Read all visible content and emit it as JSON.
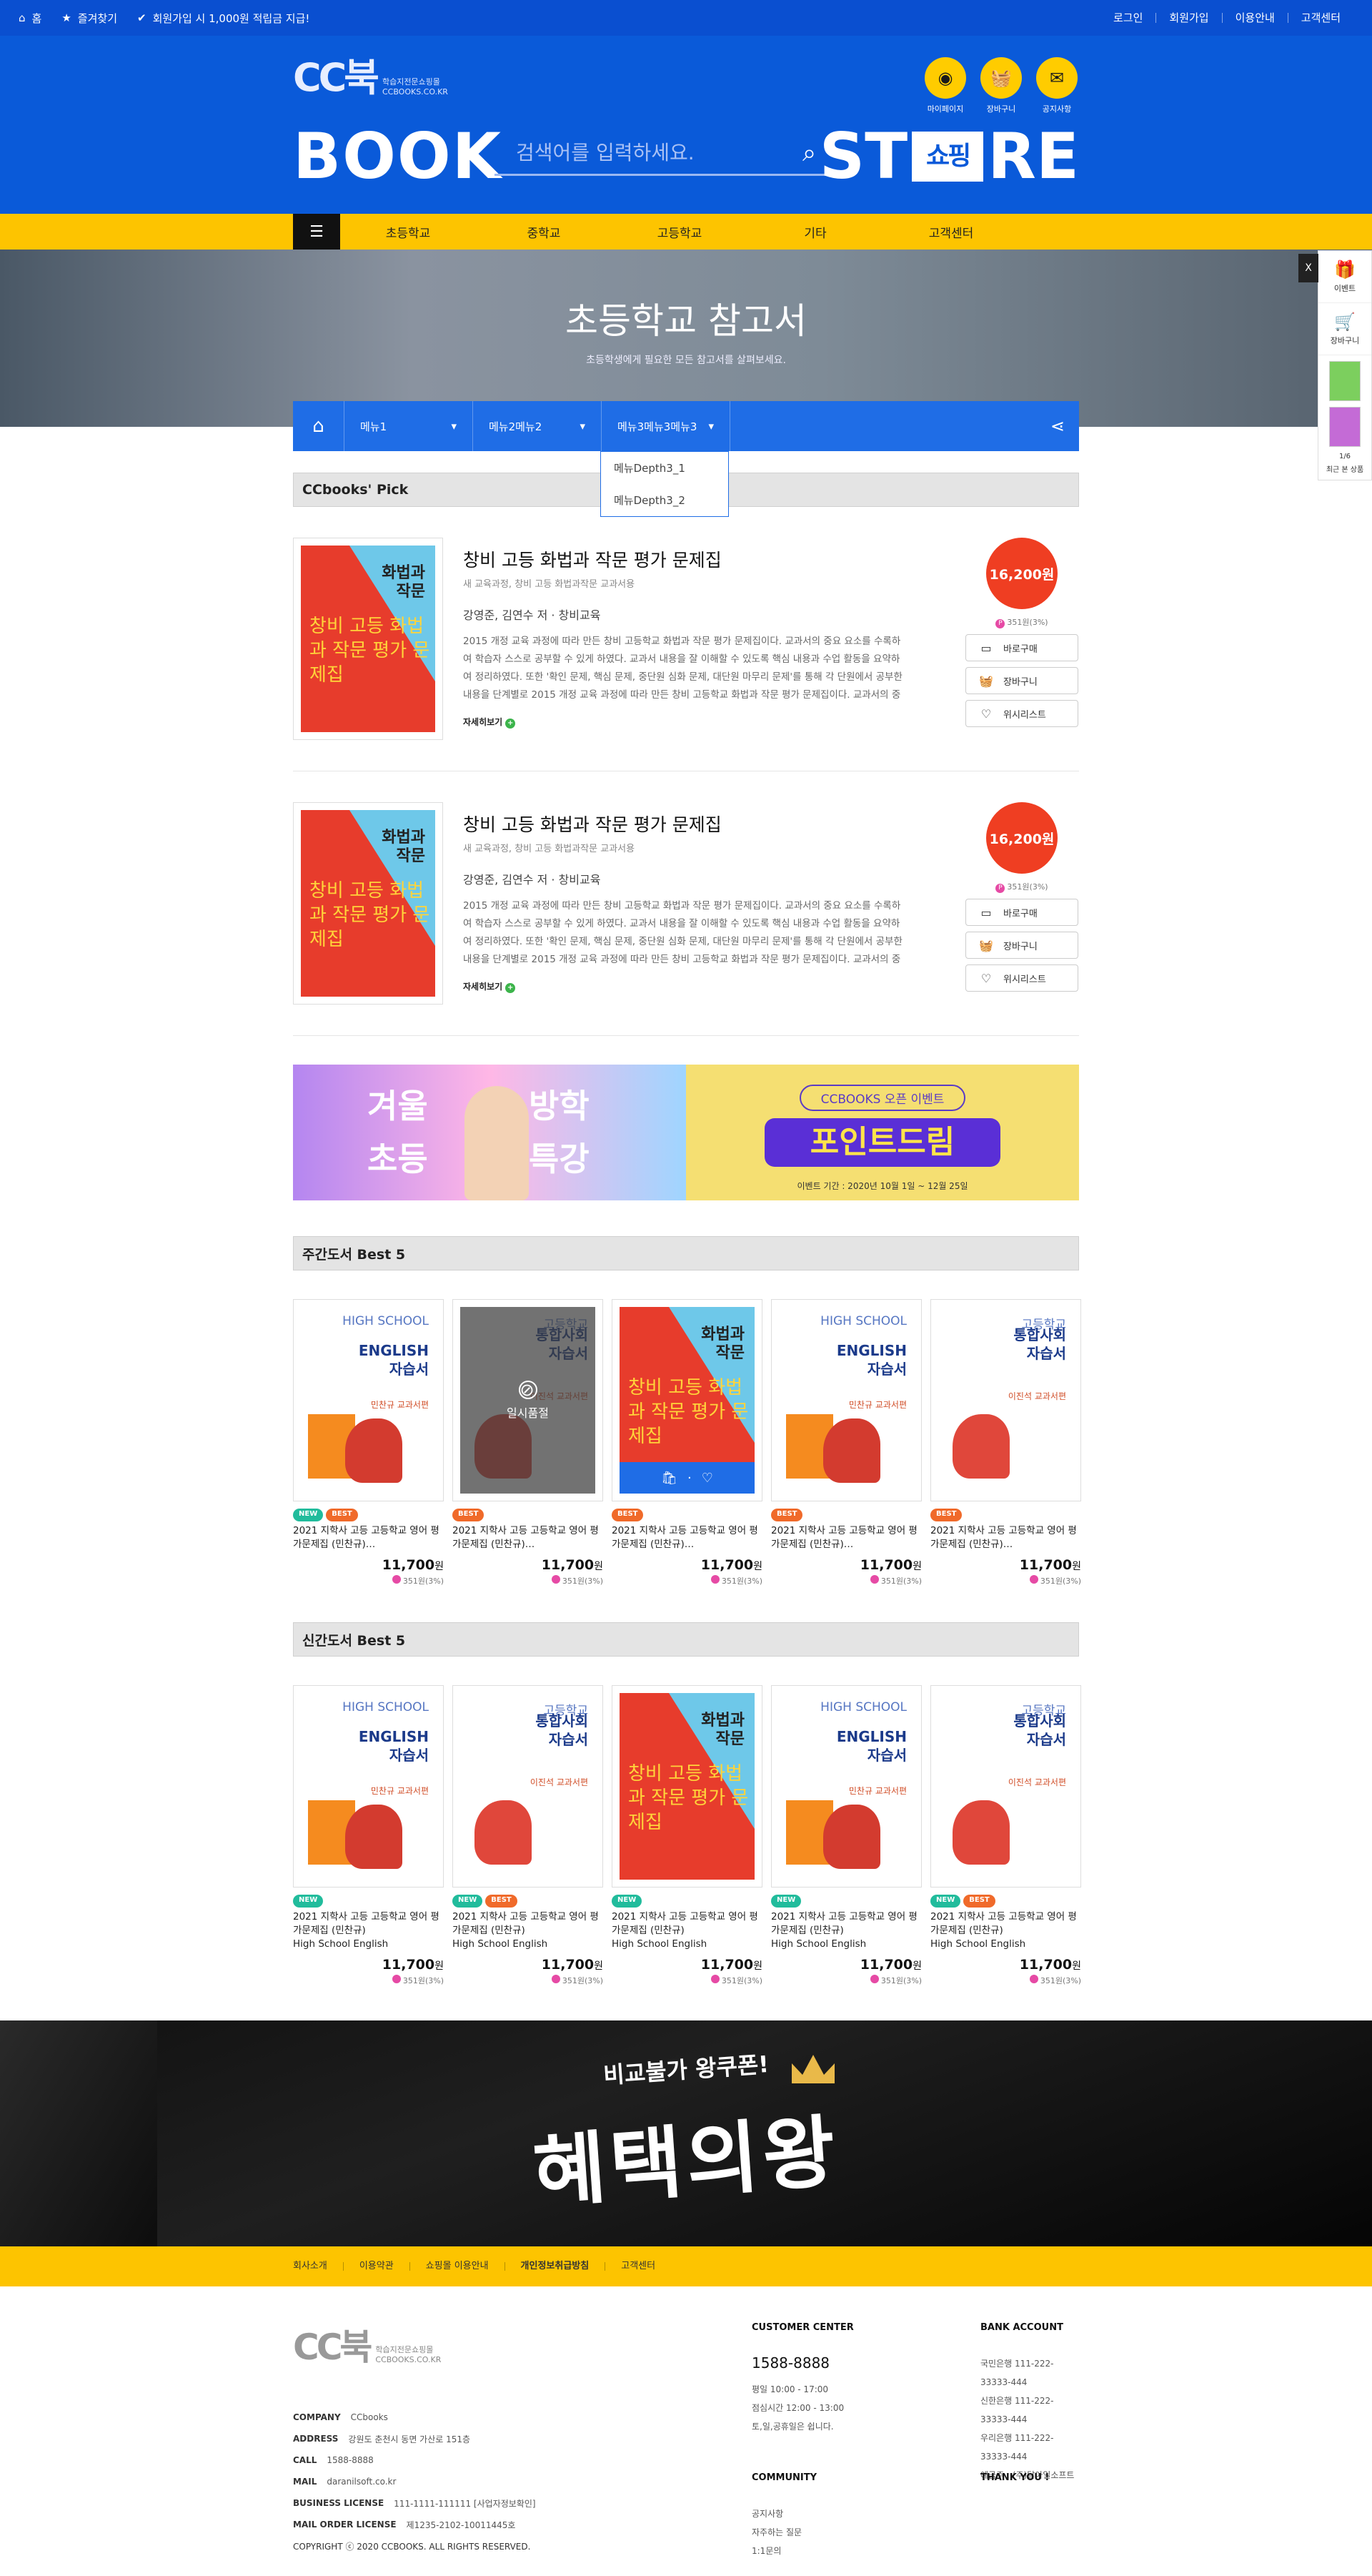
{
  "topbar": {
    "home": "홈",
    "fav": "즐겨찾기",
    "promo": "회원가입 시 1,000원 적립금 지급!",
    "login": "로그인",
    "join": "회원가입",
    "guide": "이용안내",
    "cs": "고객센터"
  },
  "header": {
    "logo_mark": "CC북",
    "logo_sub1": "학습지전문쇼핑몰",
    "logo_sub2": "CCBOOKS.CO.KR",
    "book": "BOOK",
    "store_a": "ST",
    "store_box": "쇼핑",
    "store_b": "RE",
    "search_placeholder": "검색어를 입력하세요.",
    "mypage": "마이페이지",
    "cart": "장바구니",
    "notice": "공지사항"
  },
  "gnb": {
    "items": [
      "초등학교",
      "중학교",
      "고등학교",
      "기타",
      "고객센터"
    ]
  },
  "hero": {
    "title": "초등학교 참고서",
    "sub": "초등학생에게 필요한 모든 참고서를 살펴보세요."
  },
  "quick": {
    "close": "X",
    "event": "이벤트",
    "cart": "장바구니",
    "recent": "최근 본 상품",
    "pager": "1/6"
  },
  "location": {
    "dd1": "메뉴1",
    "dd2": "메뉴2메뉴2",
    "dd3": "메뉴3메뉴3메뉴3",
    "sub1": "메뉴Depth3_1",
    "sub2": "메뉴Depth3_2"
  },
  "pick": {
    "title": "CCbooks' Pick",
    "items": [
      {
        "name": "창비 고등 화법과 작문 평가 문제집",
        "cat": "새 교육과정, 창비 고등 화법과작문 교과서용",
        "author": "강영준, 김연수 저 · 창비교육",
        "desc": "2015 개정 교육 과정에 따라 만든 창비 고등학교 화법과 작문 평가 문제집이다. 교과서의 중요 요소를 수록하여 학습자 스스로 공부할 수 있게 하였다. 교과서 내용을 잘 이해할 수 있도록 핵심 내용과 수업 활동을 요약하여 정리하였다. 또한 '확인 문제, 핵심 문제, 중단원 심화 문제, 대단원 마무리 문제'를 통해 각 단원에서 공부한 내용을 단계별로 2015 개정 교육 과정에 따라 만든 창비 고등학교 화법과 작문 평가 문제집이다. 교과서의 중요 요소를 수록하여",
        "more": "자세히보기",
        "price": "16,200원",
        "point": "351원(3%)"
      },
      {
        "name": "창비 고등 화법과 작문 평가 문제집",
        "cat": "새 교육과정, 창비 고등 화법과작문 교과서용",
        "author": "강영준, 김연수 저 · 창비교육",
        "desc": "2015 개정 교육 과정에 따라 만든 창비 고등학교 화법과 작문 평가 문제집이다. 교과서의 중요 요소를 수록하여 학습자 스스로 공부할 수 있게 하였다. 교과서 내용을 잘 이해할 수 있도록 핵심 내용과 수업 활동을 요약하여 정리하였다. 또한 '확인 문제, 핵심 문제, 중단원 심화 문제, 대단원 마무리 문제'를 통해 각 단원에서 공부한 내용을 단계별로 2015 개정 교육 과정에 따라 만든 창비 고등학교 화법과 작문 평가 문제집이다. 교과서의 중요 요소를 수록하여",
        "more": "자세히보기",
        "price": "16,200원",
        "point": "351원(3%)"
      }
    ],
    "buy": "바로구매",
    "cart": "장바구니",
    "wish": "위시리스트"
  },
  "cover": {
    "red_t1a": "화법과",
    "red_t1b": "작문",
    "red_t2": "창비 고등 화법과 작문 평가 문제집",
    "w_eng0": "HIGH SCHOOL",
    "w_eng1": "ENGLISH",
    "w_eng2": "자습서",
    "w_eng3": "민찬규 교과서편",
    "w_soc0": "고등학교",
    "w_soc1": "통합사회",
    "w_soc2": "자습서",
    "w_soc3": "이진석 교과서편"
  },
  "banner": {
    "l_a": "겨울",
    "l_b": "초등",
    "l_c": "방학",
    "l_d": "특강",
    "r_tag": "CCBOOKS 오픈 이벤트",
    "r_big": "포인트드림",
    "r_period": "이벤트 기간 : 2020년 10월 1일 ~ 12월 25일"
  },
  "weekly": {
    "title": "주간도서 Best 5",
    "soldout": "일시품절",
    "items": [
      {
        "name": "2021 지학사 고등 고등학교 영어 평가문제집 (민찬규)…",
        "price": "11,700",
        "point": "351원(3%)"
      },
      {
        "name": "2021 지학사 고등 고등학교 영어 평가문제집 (민찬규)…",
        "price": "11,700",
        "point": "351원(3%)"
      },
      {
        "name": "2021 지학사 고등 고등학교 영어 평가문제집 (민찬규)…",
        "price": "11,700",
        "point": "351원(3%)"
      },
      {
        "name": "2021 지학사 고등 고등학교 영어 평가문제집 (민찬규)…",
        "price": "11,700",
        "point": "351원(3%)"
      },
      {
        "name": "2021 지학사 고등 고등학교 영어 평가문제집 (민찬규)…",
        "price": "11,700",
        "point": "351원(3%)"
      }
    ]
  },
  "newbook": {
    "title": "신간도서 Best 5",
    "items": [
      {
        "name": "2021 지학사 고등 고등학교 영어 평가문제집 (민찬규)",
        "en": "High School English",
        "price": "11,700",
        "point": "351원(3%)"
      },
      {
        "name": "2021 지학사 고등 고등학교 영어 평가문제집 (민찬규)",
        "en": "High School English",
        "price": "11,700",
        "point": "351원(3%)"
      },
      {
        "name": "2021 지학사 고등 고등학교 영어 평가문제집 (민찬규)",
        "en": "High School English",
        "price": "11,700",
        "point": "351원(3%)"
      },
      {
        "name": "2021 지학사 고등 고등학교 영어 평가문제집 (민찬규)",
        "en": "High School English",
        "price": "11,700",
        "point": "351원(3%)"
      },
      {
        "name": "2021 지학사 고등 고등학교 영어 평가문제집 (민찬규)",
        "en": "High School English",
        "price": "11,700",
        "point": "351원(3%)"
      }
    ]
  },
  "badge": {
    "new": "NEW",
    "best": "BEST"
  },
  "won": "원",
  "event": {
    "s1": "비교불가 왕쿠폰!",
    "s2": "혜택의왕"
  },
  "fnav": [
    "회사소개",
    "이용약관",
    "쇼핑몰 이용안내",
    "개인정보취급방침",
    "고객센터"
  ],
  "footer": {
    "company_l": "COMPANY",
    "company": "CCbooks",
    "address_l": "ADDRESS",
    "address": "강원도 춘천시 동면 가산로 151층",
    "call_l": "CALL",
    "call": "1588-8888",
    "mail_l": "MAIL",
    "mail": "daranilsoft.co.kr",
    "biz_l": "BUSINESS LICENSE",
    "biz": "111-1111-111111 [사업자정보확인]",
    "order_l": "MAIL ORDER LICENSE",
    "order": "제1235-2102-10011445호",
    "copy": "COPYRIGHT ⓒ 2020 CCBOOKS. ALL RIGHTS RESERVED.",
    "cc_title": "CUSTOMER CENTER",
    "cc_tel": "1588-8888",
    "cc_1": "평일 10:00 - 17:00",
    "cc_2": "점심시간 12:00 - 13:00",
    "cc_3": "토,일,공휴일은 쉽니다.",
    "bank_title": "BANK ACCOUNT",
    "bank_1": "국민은행 111-222-33333-444",
    "bank_2": "신한은행 111-222-33333-444",
    "bank_3": "우리은행 111-222-33333-444",
    "bank_4": "예금주 : (주)달아일소프트",
    "comm_title": "COMMUNITY",
    "comm_1": "공지사항",
    "comm_2": "자주하는 질문",
    "comm_3": "1:1문의",
    "thanks": "THANK YOU !"
  }
}
